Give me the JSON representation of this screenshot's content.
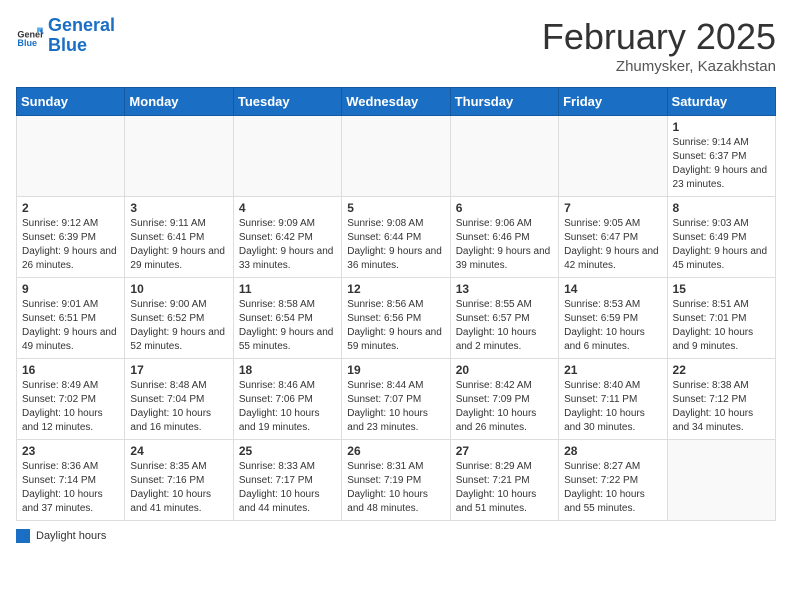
{
  "logo": {
    "line1": "General",
    "line2": "Blue"
  },
  "title": "February 2025",
  "subtitle": "Zhumysker, Kazakhstan",
  "days_of_week": [
    "Sunday",
    "Monday",
    "Tuesday",
    "Wednesday",
    "Thursday",
    "Friday",
    "Saturday"
  ],
  "weeks": [
    [
      {
        "day": "",
        "info": ""
      },
      {
        "day": "",
        "info": ""
      },
      {
        "day": "",
        "info": ""
      },
      {
        "day": "",
        "info": ""
      },
      {
        "day": "",
        "info": ""
      },
      {
        "day": "",
        "info": ""
      },
      {
        "day": "1",
        "info": "Sunrise: 9:14 AM\nSunset: 6:37 PM\nDaylight: 9 hours and 23 minutes."
      }
    ],
    [
      {
        "day": "2",
        "info": "Sunrise: 9:12 AM\nSunset: 6:39 PM\nDaylight: 9 hours and 26 minutes."
      },
      {
        "day": "3",
        "info": "Sunrise: 9:11 AM\nSunset: 6:41 PM\nDaylight: 9 hours and 29 minutes."
      },
      {
        "day": "4",
        "info": "Sunrise: 9:09 AM\nSunset: 6:42 PM\nDaylight: 9 hours and 33 minutes."
      },
      {
        "day": "5",
        "info": "Sunrise: 9:08 AM\nSunset: 6:44 PM\nDaylight: 9 hours and 36 minutes."
      },
      {
        "day": "6",
        "info": "Sunrise: 9:06 AM\nSunset: 6:46 PM\nDaylight: 9 hours and 39 minutes."
      },
      {
        "day": "7",
        "info": "Sunrise: 9:05 AM\nSunset: 6:47 PM\nDaylight: 9 hours and 42 minutes."
      },
      {
        "day": "8",
        "info": "Sunrise: 9:03 AM\nSunset: 6:49 PM\nDaylight: 9 hours and 45 minutes."
      }
    ],
    [
      {
        "day": "9",
        "info": "Sunrise: 9:01 AM\nSunset: 6:51 PM\nDaylight: 9 hours and 49 minutes."
      },
      {
        "day": "10",
        "info": "Sunrise: 9:00 AM\nSunset: 6:52 PM\nDaylight: 9 hours and 52 minutes."
      },
      {
        "day": "11",
        "info": "Sunrise: 8:58 AM\nSunset: 6:54 PM\nDaylight: 9 hours and 55 minutes."
      },
      {
        "day": "12",
        "info": "Sunrise: 8:56 AM\nSunset: 6:56 PM\nDaylight: 9 hours and 59 minutes."
      },
      {
        "day": "13",
        "info": "Sunrise: 8:55 AM\nSunset: 6:57 PM\nDaylight: 10 hours and 2 minutes."
      },
      {
        "day": "14",
        "info": "Sunrise: 8:53 AM\nSunset: 6:59 PM\nDaylight: 10 hours and 6 minutes."
      },
      {
        "day": "15",
        "info": "Sunrise: 8:51 AM\nSunset: 7:01 PM\nDaylight: 10 hours and 9 minutes."
      }
    ],
    [
      {
        "day": "16",
        "info": "Sunrise: 8:49 AM\nSunset: 7:02 PM\nDaylight: 10 hours and 12 minutes."
      },
      {
        "day": "17",
        "info": "Sunrise: 8:48 AM\nSunset: 7:04 PM\nDaylight: 10 hours and 16 minutes."
      },
      {
        "day": "18",
        "info": "Sunrise: 8:46 AM\nSunset: 7:06 PM\nDaylight: 10 hours and 19 minutes."
      },
      {
        "day": "19",
        "info": "Sunrise: 8:44 AM\nSunset: 7:07 PM\nDaylight: 10 hours and 23 minutes."
      },
      {
        "day": "20",
        "info": "Sunrise: 8:42 AM\nSunset: 7:09 PM\nDaylight: 10 hours and 26 minutes."
      },
      {
        "day": "21",
        "info": "Sunrise: 8:40 AM\nSunset: 7:11 PM\nDaylight: 10 hours and 30 minutes."
      },
      {
        "day": "22",
        "info": "Sunrise: 8:38 AM\nSunset: 7:12 PM\nDaylight: 10 hours and 34 minutes."
      }
    ],
    [
      {
        "day": "23",
        "info": "Sunrise: 8:36 AM\nSunset: 7:14 PM\nDaylight: 10 hours and 37 minutes."
      },
      {
        "day": "24",
        "info": "Sunrise: 8:35 AM\nSunset: 7:16 PM\nDaylight: 10 hours and 41 minutes."
      },
      {
        "day": "25",
        "info": "Sunrise: 8:33 AM\nSunset: 7:17 PM\nDaylight: 10 hours and 44 minutes."
      },
      {
        "day": "26",
        "info": "Sunrise: 8:31 AM\nSunset: 7:19 PM\nDaylight: 10 hours and 48 minutes."
      },
      {
        "day": "27",
        "info": "Sunrise: 8:29 AM\nSunset: 7:21 PM\nDaylight: 10 hours and 51 minutes."
      },
      {
        "day": "28",
        "info": "Sunrise: 8:27 AM\nSunset: 7:22 PM\nDaylight: 10 hours and 55 minutes."
      },
      {
        "day": "",
        "info": ""
      }
    ]
  ],
  "legend": {
    "box_label": "Daylight hours"
  }
}
